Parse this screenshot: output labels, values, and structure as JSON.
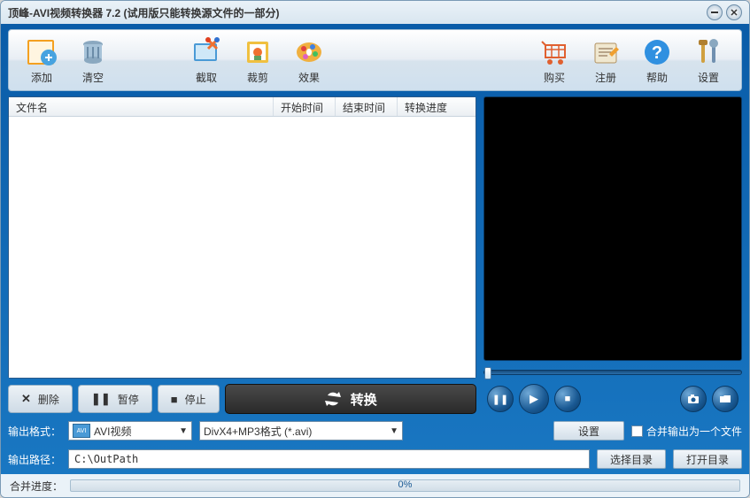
{
  "title": "顶峰-AVI视频转换器 7.2 (试用版只能转换源文件的一部分)",
  "toolbar": {
    "add": "添加",
    "clear": "清空",
    "capture": "截取",
    "crop": "裁剪",
    "effect": "效果",
    "buy": "购买",
    "register": "注册",
    "help": "帮助",
    "settings": "设置"
  },
  "list_headers": {
    "filename": "文件名",
    "start": "开始时间",
    "end": "结束时间",
    "progress": "转换进度"
  },
  "actions": {
    "delete": "删除",
    "pause": "暂停",
    "stop": "停止",
    "convert": "转换"
  },
  "output": {
    "format_label": "输出格式：",
    "format_icon_text": "AVI",
    "format1": "AVI视频",
    "format2": "DivX4+MP3格式 (*.avi)",
    "settings_btn": "设置",
    "merge_checkbox": "合并输出为一个文件",
    "path_label": "输出路径：",
    "path_value": "C:\\OutPath",
    "choose_dir": "选择目录",
    "open_dir": "打开目录"
  },
  "status": {
    "label": "合并进度：",
    "percent": "0%"
  }
}
